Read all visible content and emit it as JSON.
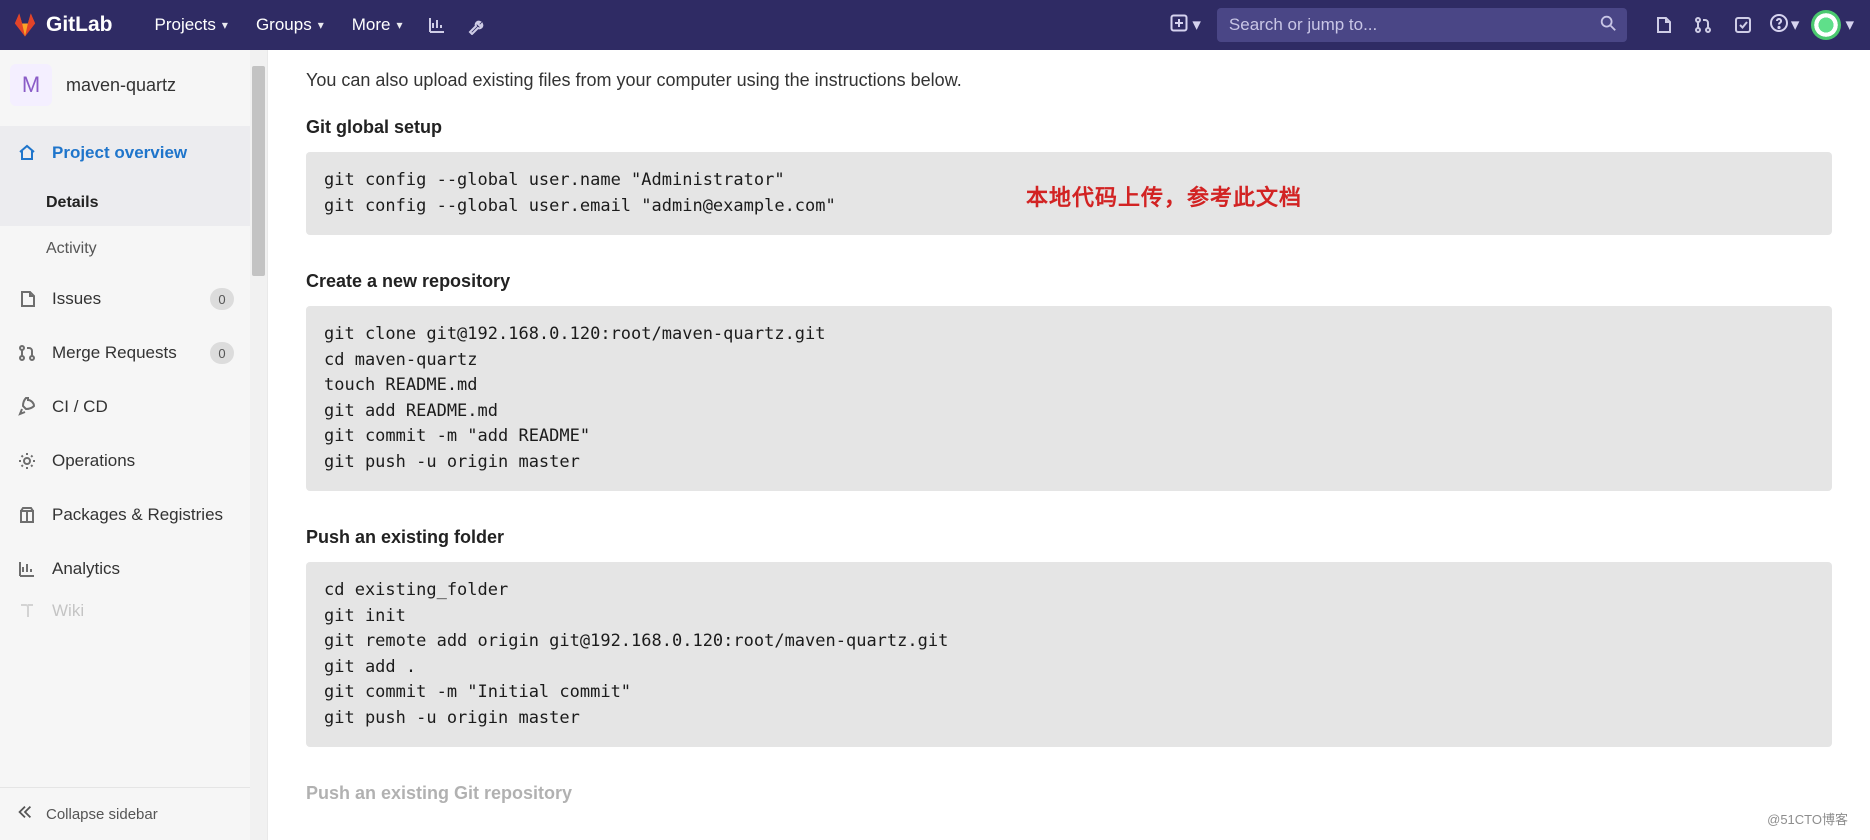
{
  "brand": {
    "name": "GitLab"
  },
  "nav": {
    "projects": "Projects",
    "groups": "Groups",
    "more": "More"
  },
  "search": {
    "placeholder": "Search or jump to..."
  },
  "project": {
    "avatar_letter": "M",
    "name": "maven-quartz"
  },
  "sidebar": {
    "overview": "Project overview",
    "sub_details": "Details",
    "sub_activity": "Activity",
    "issues": {
      "label": "Issues",
      "count": "0"
    },
    "merge_requests": {
      "label": "Merge Requests",
      "count": "0"
    },
    "cicd": "CI / CD",
    "operations": "Operations",
    "packages": "Packages & Registries",
    "analytics": "Analytics",
    "wiki": "Wiki",
    "collapse": "Collapse sidebar"
  },
  "content": {
    "intro": "You can also upload existing files from your computer using the instructions below.",
    "annotation": "本地代码上传，参考此文档",
    "sec1_title": "Git global setup",
    "sec1_code": "git config --global user.name \"Administrator\"\ngit config --global user.email \"admin@example.com\"",
    "sec2_title": "Create a new repository",
    "sec2_code": "git clone git@192.168.0.120:root/maven-quartz.git\ncd maven-quartz\ntouch README.md\ngit add README.md\ngit commit -m \"add README\"\ngit push -u origin master",
    "sec3_title": "Push an existing folder",
    "sec3_code": "cd existing_folder\ngit init\ngit remote add origin git@192.168.0.120:root/maven-quartz.git\ngit add .\ngit commit -m \"Initial commit\"\ngit push -u origin master",
    "sec4_title": "Push an existing Git repository"
  },
  "watermark": "@51CTO博客"
}
